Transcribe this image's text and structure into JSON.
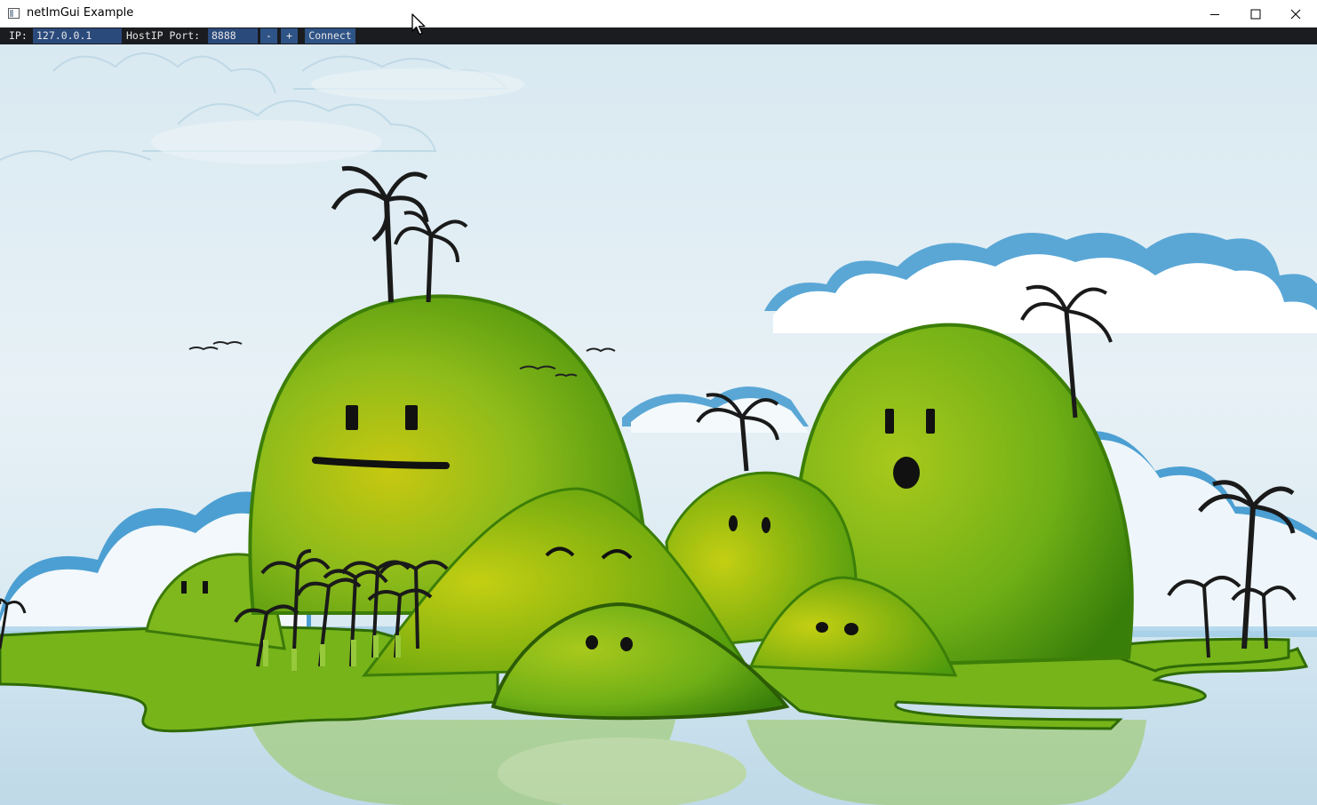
{
  "window": {
    "title": "netImGui Example"
  },
  "toolbar": {
    "ip_label": "IP:",
    "ip_value": "127.0.0.1",
    "hostip_label": "HostIP Port:",
    "port_value": "8888",
    "minus_label": "-",
    "plus_label": "+",
    "connect_label": "Connect"
  },
  "icons": {
    "app": "app-window-icon",
    "minimize": "minimize-icon",
    "maximize": "maximize-icon",
    "close": "close-icon",
    "cursor": "mouse-pointer-icon"
  },
  "colors": {
    "toolbar_bg": "#1a1c1f",
    "field_bg": "#2b4a7c",
    "button_bg": "#2e5386",
    "text": "#e6e6e6"
  }
}
